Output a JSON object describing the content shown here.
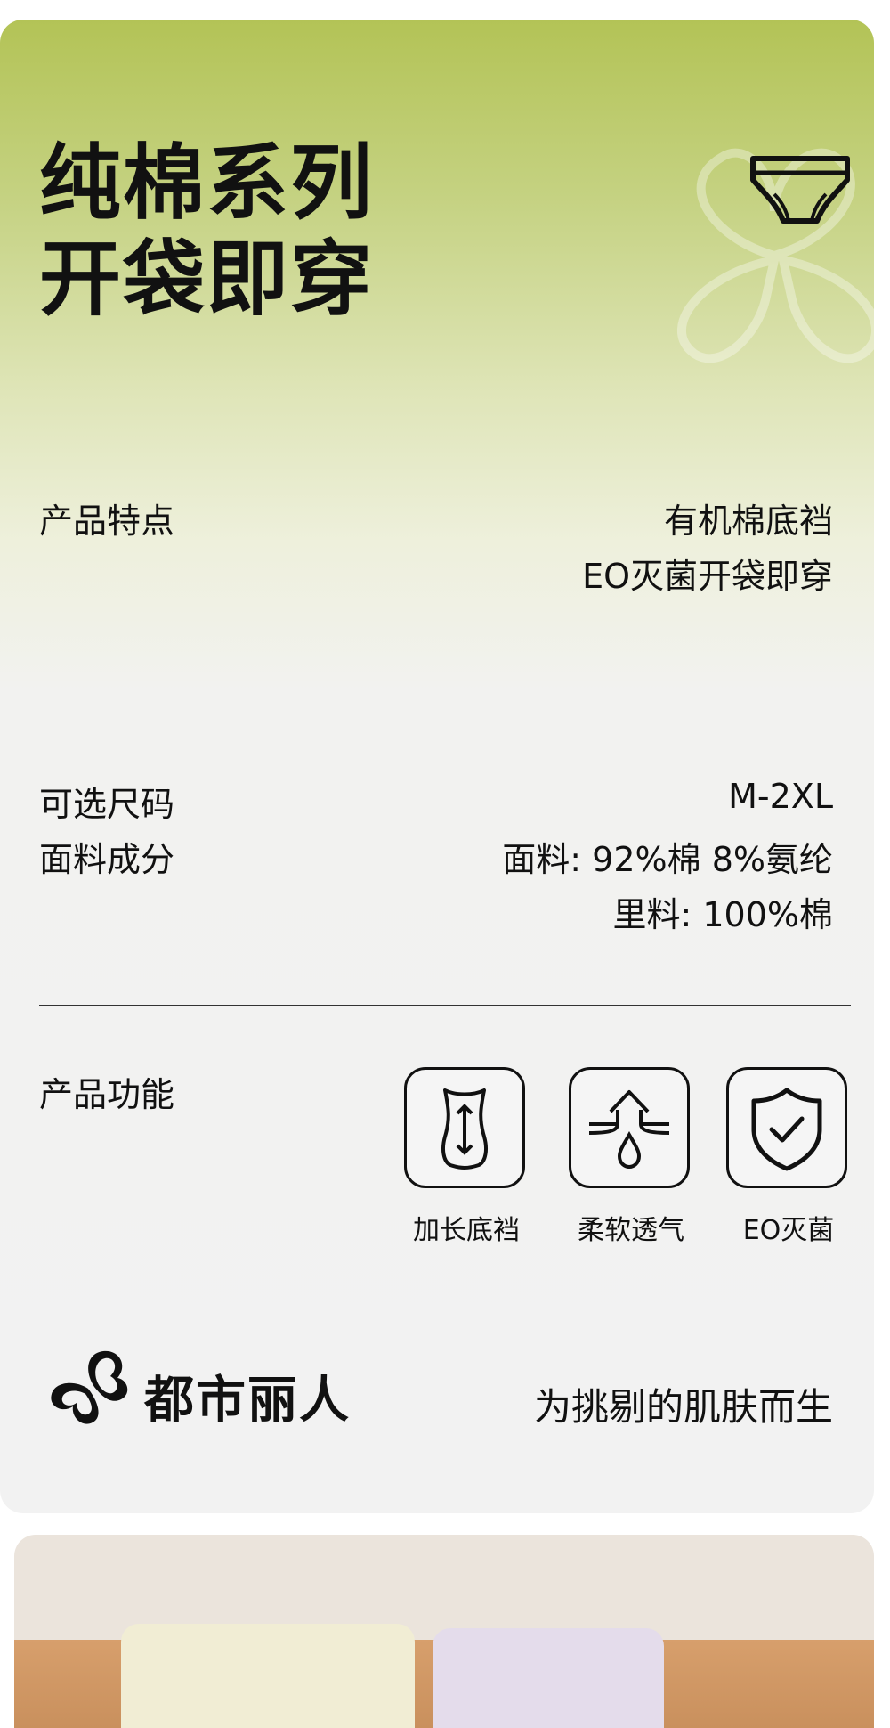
{
  "header": {
    "title_line1": "纯棉系列",
    "title_line2": "开袋即穿",
    "icon": "briefs-icon"
  },
  "features": {
    "label": "产品特点",
    "values": [
      "有机棉底裆",
      "EO灭菌开袋即穿"
    ]
  },
  "specs": {
    "size_label": "可选尺码",
    "size_value": "M-2XL",
    "fabric_label": "面料成分",
    "fabric_values": [
      "面料: 92%棉 8%氨纶",
      "里料: 100%棉"
    ]
  },
  "functions": {
    "label": "产品功能",
    "items": [
      {
        "icon": "lengthened-crotch-icon",
        "label": "加长底裆"
      },
      {
        "icon": "breathable-icon",
        "label": "柔软透气"
      },
      {
        "icon": "shield-check-icon",
        "label": "EO灭菌"
      }
    ]
  },
  "brand": {
    "logo_text": "都市丽人",
    "slogan": "为挑剔的肌肤而生"
  },
  "colors": {
    "accent_green": "#b3c356",
    "background": "#f2f2f2",
    "text": "#111111"
  }
}
